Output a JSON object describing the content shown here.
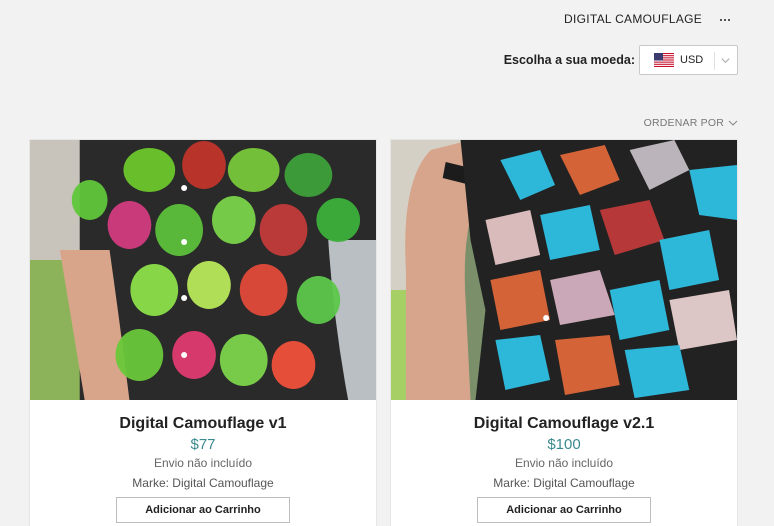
{
  "header": {
    "store_name": "DIGITAL CAMOUFLAGE"
  },
  "currency": {
    "label": "Escolha a sua moeda:",
    "selected": "USD",
    "flag_icon": "us-flag-icon"
  },
  "sort": {
    "label": "ORDENAR POR"
  },
  "products": [
    {
      "name": "Digital Camouflage v1",
      "price": "$77",
      "shipping": "Envio não incluído",
      "brand": "Marke: Digital Camouflage",
      "button": "Adicionar ao Carrinho"
    },
    {
      "name": "Digital Camouflage v2.1",
      "price": "$100",
      "shipping": "Envio não incluído",
      "brand": "Marke: Digital Camouflage",
      "button": "Adicionar ao Carrinho"
    }
  ],
  "colors": {
    "price": "#3b8a8f",
    "background": "#f2f2f2"
  }
}
